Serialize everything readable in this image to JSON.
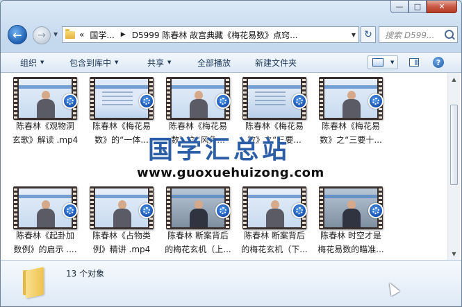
{
  "window": {
    "caption": {
      "minimize": "—",
      "maximize": "□",
      "close": "✕"
    }
  },
  "address": {
    "overflow": "«",
    "segments": [
      "国学...",
      "D5999 陈春林 故宫典藏《梅花易数》点窍..."
    ],
    "search_placeholder": "搜索 D599..."
  },
  "toolbar": {
    "organize": "组织",
    "include_library": "包含到库中",
    "share": "共享",
    "play_all": "全部播放",
    "new_folder": "新建文件夹"
  },
  "files": [
    {
      "line1": "陈春林《观物洞",
      "line2": "玄歌》解读 .mp4",
      "thumb": "lecture"
    },
    {
      "line1": "陈春林《梅花易",
      "line2": "数》的“一体...",
      "thumb": "text"
    },
    {
      "line1": "陈春林《梅花易",
      "line2": "数》之“风角...",
      "thumb": "lecture"
    },
    {
      "line1": "陈春林《梅花易",
      "line2": "数》之“三要...",
      "thumb": "title"
    },
    {
      "line1": "陈春林《梅花易",
      "line2": "数》之“三要十...",
      "thumb": "lecture"
    },
    {
      "line1": "陈春林《起卦加",
      "line2": "数例》的启示 ....",
      "thumb": "lecture"
    },
    {
      "line1": "陈春林《占物类",
      "line2": "例》精讲 .mp4",
      "thumb": "lecture"
    },
    {
      "line1": "陈春林 断案背后",
      "line2": "的梅花玄机（上...",
      "thumb": "dark"
    },
    {
      "line1": "陈春林 断案背后",
      "line2": "的梅花玄机（下...",
      "thumb": "lecture"
    },
    {
      "line1": "陈春林 时空才是",
      "line2": "梅花易数的瞄准...",
      "thumb": "dark"
    }
  ],
  "watermark": {
    "title": "国学汇总站",
    "url": "www.guoxuehuizong.com"
  },
  "details": {
    "count": "13 个对象"
  },
  "colors": {
    "accent": "#1f5fb2",
    "watermark": "#2c5ea8",
    "close": "#c75a45"
  }
}
